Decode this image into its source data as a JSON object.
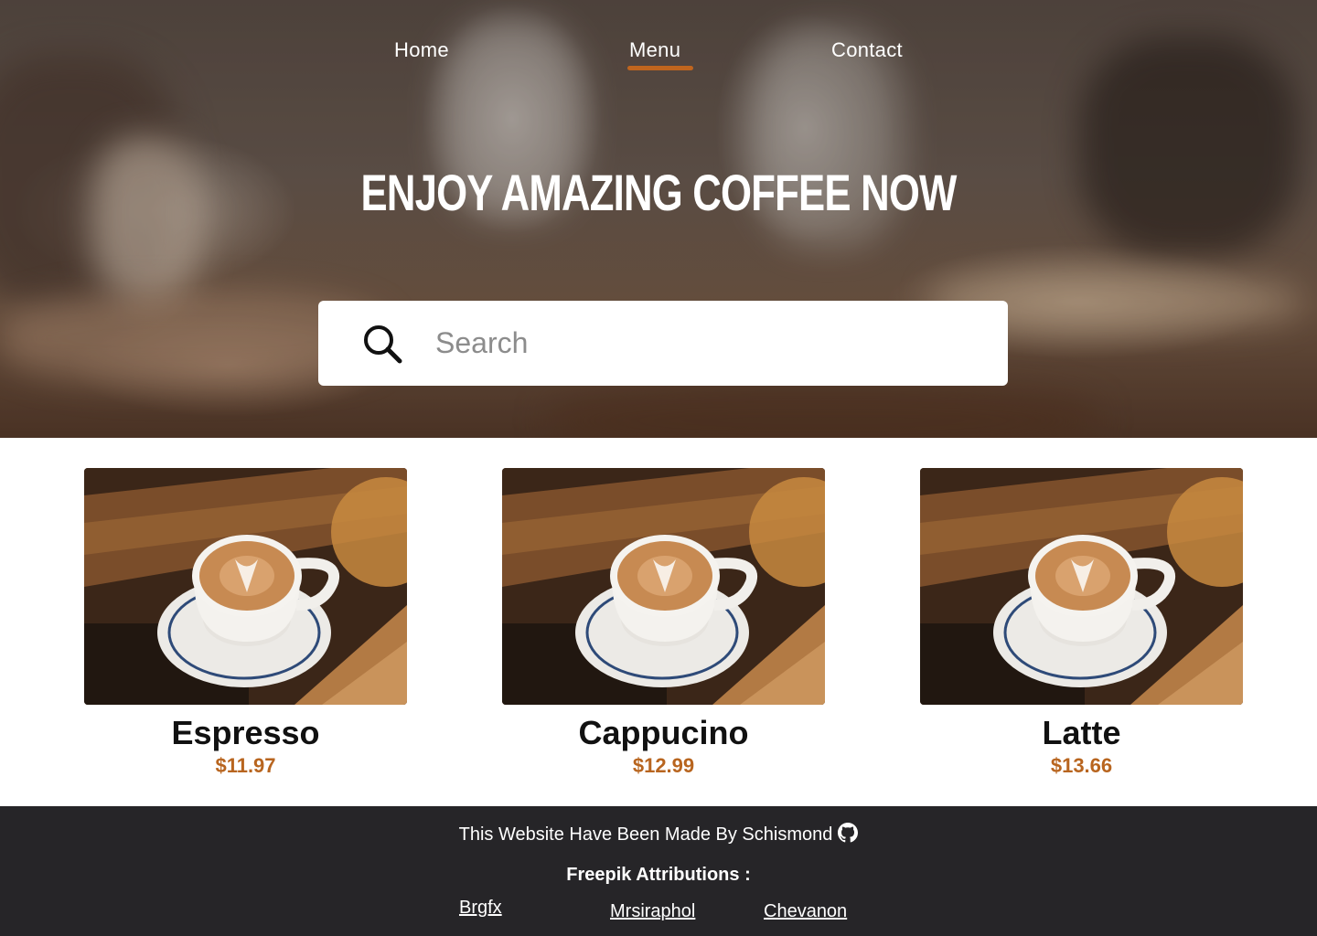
{
  "nav": {
    "items": [
      {
        "label": "Home"
      },
      {
        "label": "Menu",
        "active": true
      },
      {
        "label": "Contact"
      }
    ],
    "active_color": "#c0651e"
  },
  "hero": {
    "title": "ENJOY AMAZING COFFEE NOW",
    "search_placeholder": "Search"
  },
  "products": [
    {
      "name": "Espresso",
      "price": "$11.97"
    },
    {
      "name": "Cappucino",
      "price": "$12.99"
    },
    {
      "name": "Latte",
      "price": "$13.66"
    }
  ],
  "colors": {
    "price": "#b8651f",
    "footer_bg": "#262528"
  },
  "footer": {
    "made_by": "This Website Have Been Made By Schismond",
    "attributions_title": "Freepik Attributions :",
    "links": [
      "Brgfx",
      "Mrsiraphol",
      "Chevanon"
    ]
  }
}
